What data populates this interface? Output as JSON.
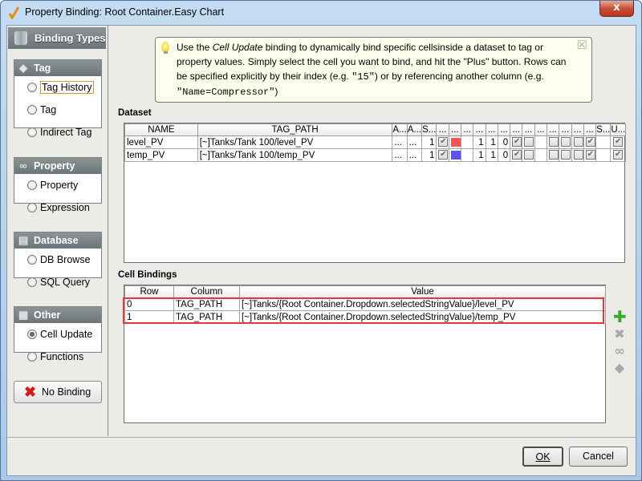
{
  "window": {
    "title": "Property Binding: Root Container.Easy Chart",
    "close_label": "x"
  },
  "sidebar": {
    "header": "Binding Types",
    "groups": [
      {
        "label": "Tag",
        "icon": "tag-icon",
        "options": [
          {
            "label": "Tag History",
            "selected": false,
            "focused": true
          },
          {
            "label": "Tag",
            "selected": false
          },
          {
            "label": "Indirect Tag",
            "selected": false
          }
        ]
      },
      {
        "label": "Property",
        "icon": "link-icon",
        "options": [
          {
            "label": "Property",
            "selected": false
          },
          {
            "label": "Expression",
            "selected": false
          }
        ]
      },
      {
        "label": "Database",
        "icon": "database-icon",
        "options": [
          {
            "label": "DB Browse",
            "selected": false
          },
          {
            "label": "SQL Query",
            "selected": false
          }
        ]
      },
      {
        "label": "Other",
        "icon": "grid-magnifier-icon",
        "options": [
          {
            "label": "Cell Update",
            "selected": true
          },
          {
            "label": "Functions",
            "selected": false
          }
        ]
      }
    ],
    "no_binding_label": "No Binding"
  },
  "info": {
    "text_1": "Use the ",
    "text_italic": "Cell Update",
    "text_2": " binding to dynamically bind specific cellsinside a dataset to tag or property values. Simply select the cell you want to bind, and hit the \"Plus\" button. Rows can be specified explicitly by their index (e.g. ",
    "example_1": "\"15\"",
    "text_3": ") or by referencing another column (e.g. ",
    "example_2": "\"Name=Compressor\"",
    "text_4": ")"
  },
  "dataset": {
    "label": "Dataset",
    "columns": [
      "NAME",
      "TAG_PATH",
      "A...",
      "A...",
      "S...",
      "...",
      "...",
      "...",
      "...",
      "...",
      "...",
      "...",
      "...",
      "...",
      "...",
      "...",
      "...",
      "...",
      "S...",
      "U..."
    ],
    "rows": [
      {
        "name": "level_PV",
        "tag_path": "[~]Tanks/Tank 100/level_PV",
        "a1": "...",
        "a2": "...",
        "s": "1",
        "chk1": true,
        "color": "#f55757",
        "n1": "1",
        "n2": "1",
        "n3": "0",
        "chk2": true,
        "chk3": false,
        "chk4": false,
        "chk5": false,
        "chk6": false,
        "chk7": true,
        "u": true
      },
      {
        "name": "temp_PV",
        "tag_path": "[~]Tanks/Tank 100/temp_PV",
        "a1": "...",
        "a2": "...",
        "s": "1",
        "chk1": true,
        "color": "#5656f2",
        "n1": "1",
        "n2": "1",
        "n3": "0",
        "chk2": true,
        "chk3": false,
        "chk4": false,
        "chk5": false,
        "chk6": false,
        "chk7": true,
        "u": true
      }
    ]
  },
  "cell_bindings": {
    "label": "Cell Bindings",
    "columns": [
      "Row",
      "Column",
      "Value"
    ],
    "rows": [
      {
        "row": "0",
        "column": "TAG_PATH",
        "value": "[~]Tanks/{Root Container.Dropdown.selectedStringValue}/level_PV"
      },
      {
        "row": "1",
        "column": "TAG_PATH",
        "value": "[~]Tanks/{Root Container.Dropdown.selectedStringValue}/temp_PV"
      }
    ],
    "tools": [
      "add-icon",
      "delete-icon",
      "link-icon",
      "tag-icon"
    ]
  },
  "buttons": {
    "ok": "OK",
    "cancel": "Cancel"
  },
  "colors": {
    "highlight": "#e0383b",
    "add": "#3aa829"
  }
}
